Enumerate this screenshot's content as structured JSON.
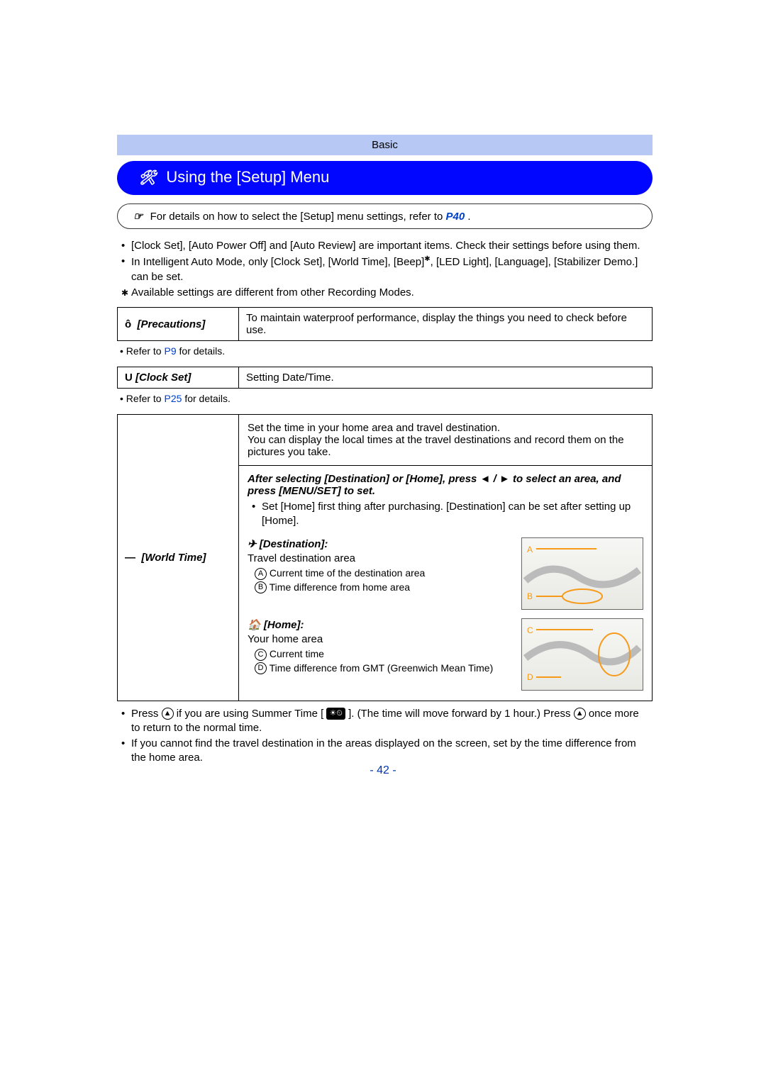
{
  "header": {
    "category": "Basic"
  },
  "title": "Using the [Setup] Menu",
  "referBox": {
    "prefix": "For details on how to select the [Setup] menu settings, refer to ",
    "link": "P40",
    "suffix": "."
  },
  "introBullets": {
    "b1": "[Clock Set], [Auto Power Off] and [Auto Review] are important items. Check their settings before using them.",
    "b2_pre": "In Intelligent Auto Mode, only [Clock Set], [World Time], [Beep]",
    "b2_post": ", [LED Light], [Language], [Stabilizer Demo.] can be set.",
    "b2_star": "Available settings are different from other Recording Modes."
  },
  "precautions": {
    "label": "[Precautions]",
    "icon_label": "ô",
    "desc": "To maintain waterproof performance, display the things you need to check before use.",
    "ref_pre": "Refer to ",
    "ref_link": "P9",
    "ref_post": " for details."
  },
  "clockSet": {
    "icon": "U",
    "label": "[Clock Set]",
    "desc": "Setting Date/Time.",
    "ref_pre": "Refer to ",
    "ref_link": "P25",
    "ref_post": " for details."
  },
  "worldTime": {
    "icon": "— ",
    "label": "[World Time]",
    "intro1": "Set the time in your home area and travel destination.",
    "intro2": "You can display the local times at the travel destinations and record them on the pictures you take.",
    "step_title": "After selecting [Destination] or [Home], press ",
    "step_sep": "/",
    "step_post": " to select an area, and press [MENU/SET] to set.",
    "step_note": "Set [Home] first thing after purchasing. [Destination] can be set after setting up [Home].",
    "opt_dest_title": "[Destination]:",
    "opt_dest_sub": "Travel destination area",
    "opt_dest_a": "Current time of the destination area",
    "opt_dest_b": "Time difference from home area",
    "opt_home_title": "[Home]:",
    "opt_home_sub": "Your home area",
    "opt_home_c": "Current time",
    "opt_home_d": "Time difference from GMT (Greenwich Mean Time)",
    "thumb_dest_a": "A",
    "thumb_dest_b": "B",
    "thumb_home_c": "C",
    "thumb_home_d": "D"
  },
  "footBullets": {
    "b1_pre": "Press ",
    "b1_btn": "▲",
    "b1_mid": " if you are using Summer Time [",
    "b1_icon": "☀⏲",
    "b1_mid2": "]. (The time will move forward by 1 hour.) Press ",
    "b1_btn2": "▲",
    "b1_post": " once more to return to the normal time.",
    "b2": "If you cannot find the travel destination in the areas displayed on the screen, set by the time difference from the home area."
  },
  "pageNumber": "- 42 -",
  "labels": {
    "lbl_A": "A",
    "lbl_B": "B",
    "lbl_C": "C",
    "lbl_D": "D"
  }
}
